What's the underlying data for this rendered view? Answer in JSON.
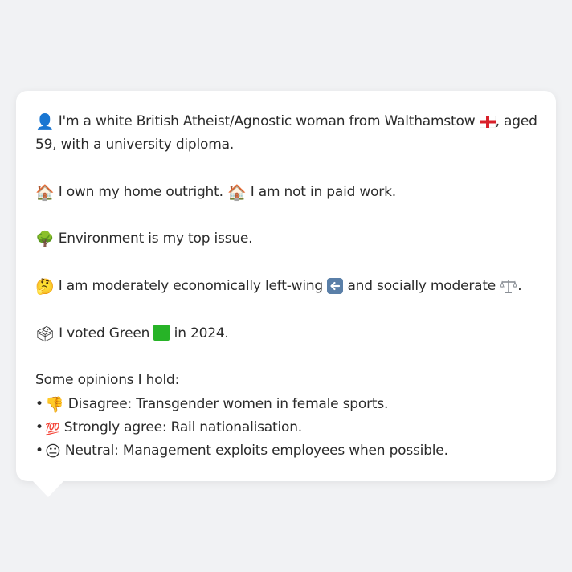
{
  "profile": {
    "intro": {
      "icon": "person-silhouette-icon",
      "text_a": "I'm a white British Atheist/Agnostic woman from Walthamstow",
      "flag": "england-flag-icon",
      "text_b": ", aged",
      "text_c": "59, with a university diploma."
    },
    "home": {
      "icon1": "house-icon",
      "text1": "I own my home outright.",
      "icon2": "house-icon",
      "text2": "I am not in paid work."
    },
    "issue": {
      "icon": "tree-icon",
      "text": "Environment is my top issue."
    },
    "politics": {
      "icon": "thinking-face-icon",
      "text_a": "I am moderately economically left-wing",
      "left_icon": "left-arrow-icon",
      "text_b": "and socially moderate",
      "scales_icon": "balance-scale-icon",
      "text_c": "."
    },
    "vote": {
      "icon": "ballot-box-icon",
      "text_a": "I voted Green",
      "swatch_icon": "green-square-icon",
      "swatch_color": "#27b327",
      "text_b": "in 2024."
    },
    "opinions": {
      "heading": "Some opinions I hold:",
      "items": [
        {
          "icon": "thumbs-down-icon",
          "text": "Disagree: Transgender women in female sports."
        },
        {
          "icon": "hundred-points-icon",
          "text": "Strongly agree: Rail nationalisation."
        },
        {
          "icon": "neutral-face-icon",
          "text": "Neutral: Management exploits employees when possible."
        }
      ]
    }
  }
}
